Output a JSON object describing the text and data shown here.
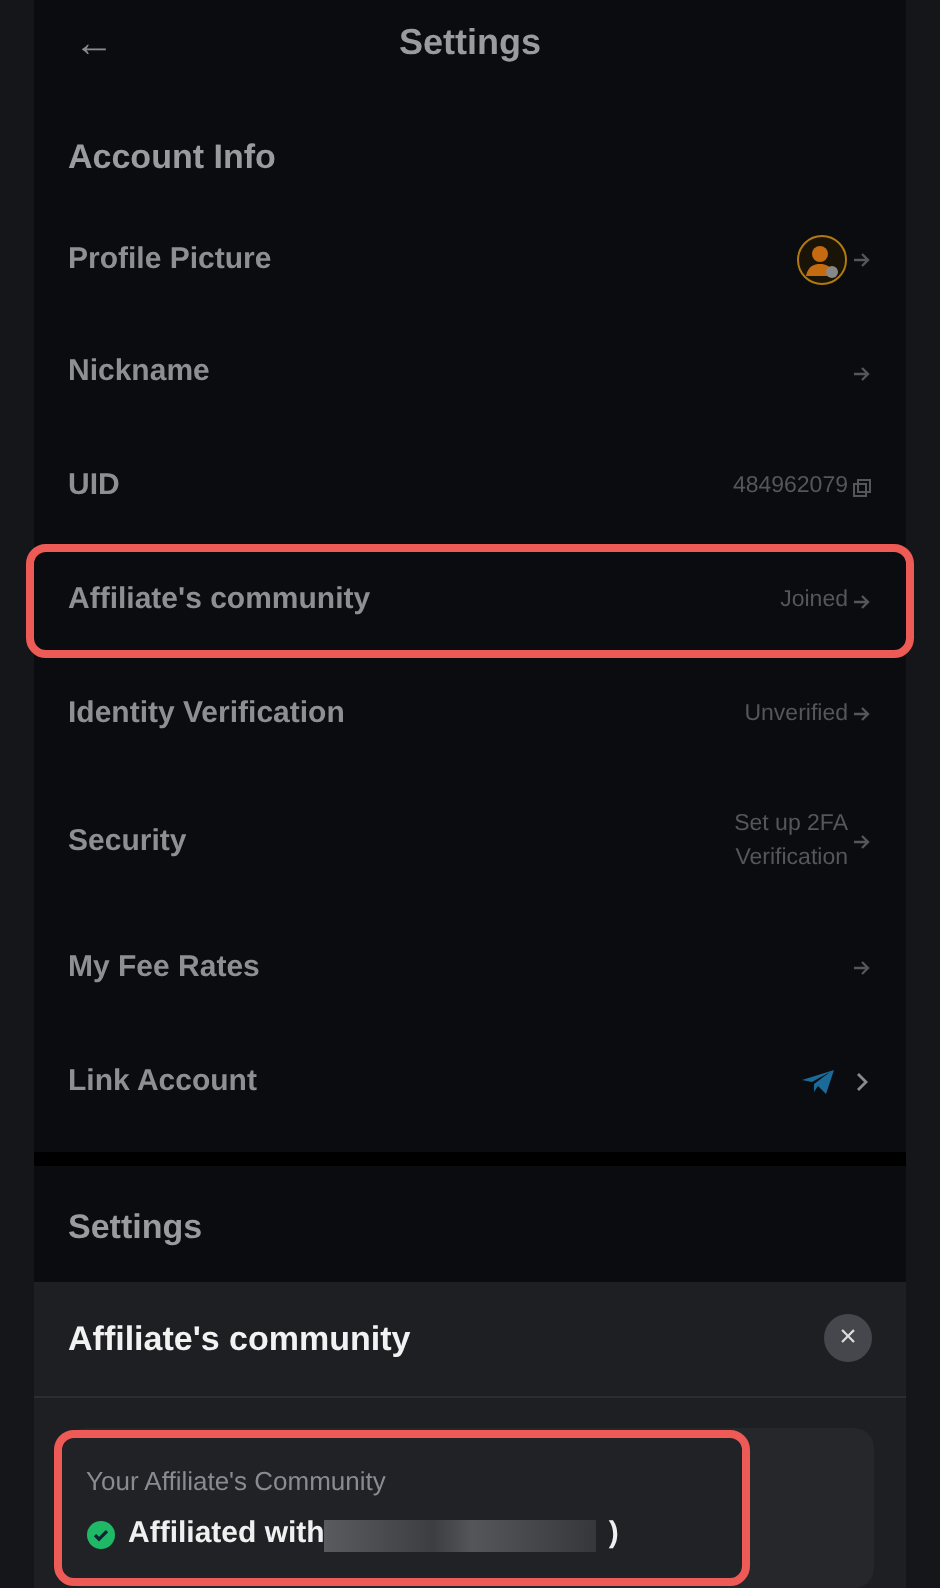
{
  "header": {
    "back": "←",
    "title": "Settings"
  },
  "account_section": {
    "heading": "Account Info",
    "rows": [
      {
        "kind": "avatar",
        "label": "Profile Picture",
        "highlight": false
      },
      {
        "kind": "arrow",
        "label": "Nickname",
        "highlight": false
      },
      {
        "kind": "copy",
        "label": "UID",
        "value": "484962079",
        "highlight": false
      },
      {
        "kind": "arrow",
        "label": "Affiliate's community",
        "value": "Joined",
        "highlight": true
      },
      {
        "kind": "arrow",
        "label": "Identity Verification",
        "value": "Unverified",
        "highlight": false
      },
      {
        "kind": "arrow",
        "label": "Security",
        "value": "Set up 2FA Verification",
        "highlight": false
      },
      {
        "kind": "arrow",
        "label": "My Fee Rates",
        "highlight": false
      },
      {
        "kind": "telegram",
        "label": "Link Account",
        "highlight": false
      }
    ]
  },
  "settings_section": {
    "heading": "Settings"
  },
  "sheet": {
    "title": "Affiliate's community",
    "close": "×",
    "card": {
      "caption": "Your Affiliate's Community",
      "status": "Affiliated with",
      "status_end": ")",
      "verified": true,
      "highlight": true
    }
  }
}
